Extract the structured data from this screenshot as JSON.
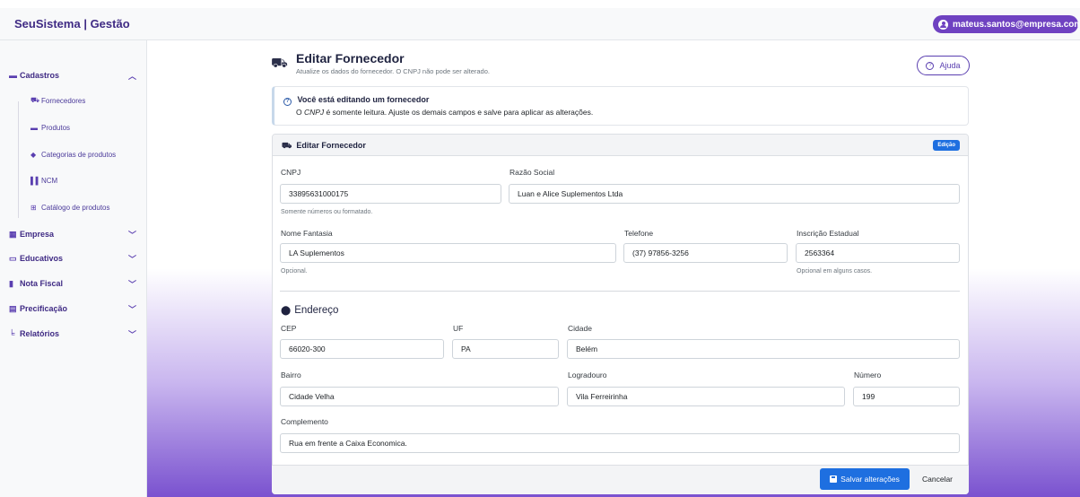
{
  "app": {
    "brand": "SeuSistema | Gestão",
    "user": "mateus.santos@empresa.com"
  },
  "sidebar": {
    "groups": [
      {
        "label": "Cadastros",
        "icon": "folder-icon",
        "expanded": true
      },
      {
        "label": "Empresa",
        "icon": "building-icon"
      },
      {
        "label": "Educativos",
        "icon": "presentation-icon"
      },
      {
        "label": "Nota Fiscal",
        "icon": "file-icon"
      },
      {
        "label": "Precificação",
        "icon": "calculator-icon"
      },
      {
        "label": "Relatórios",
        "icon": "chart-icon"
      }
    ],
    "cadastros_items": [
      {
        "label": "Fornecedores",
        "icon": "truck-icon"
      },
      {
        "label": "Produtos",
        "icon": "box-icon"
      },
      {
        "label": "Categorias de produtos",
        "icon": "tag-icon"
      },
      {
        "label": "NCM",
        "icon": "barcode-icon"
      },
      {
        "label": "Catálogo de produtos",
        "icon": "grid-icon"
      }
    ]
  },
  "page": {
    "title": "Editar Fornecedor",
    "subtitle": "Atualize os dados do fornecedor. O CNPJ não pode ser alterado.",
    "help_label": "Ajuda"
  },
  "alert": {
    "title": "Você está editando um fornecedor",
    "text_pre": "O ",
    "text_em": "CNPJ",
    "text_post": " é somente leitura. Ajuste os demais campos e salve para aplicar as alterações."
  },
  "card": {
    "title": "Editar Fornecedor",
    "badge": "Edição"
  },
  "form": {
    "cnpj": {
      "label": "CNPJ",
      "value": "33895631000175",
      "hint": "Somente números ou formatado."
    },
    "razao": {
      "label": "Razão Social",
      "value": "Luan e Alice Suplementos Ltda"
    },
    "fantasia": {
      "label": "Nome Fantasia",
      "value": "LA Suplementos",
      "hint": "Opcional."
    },
    "telefone": {
      "label": "Telefone",
      "value": "(37) 97856-3256"
    },
    "ie": {
      "label": "Inscrição Estadual",
      "value": "2563364",
      "hint": "Opcional em alguns casos."
    },
    "endereco_title": "Endereço",
    "cep": {
      "label": "CEP",
      "value": "66020-300"
    },
    "uf": {
      "label": "UF",
      "value": "PA"
    },
    "cidade": {
      "label": "Cidade",
      "value": "Belém"
    },
    "bairro": {
      "label": "Bairro",
      "value": "Cidade Velha"
    },
    "logradouro": {
      "label": "Logradouro",
      "value": "Vila Ferreirinha"
    },
    "numero": {
      "label": "Número",
      "value": "199"
    },
    "complemento": {
      "label": "Complemento",
      "value": "Rua em frente a Caixa Economica."
    }
  },
  "actions": {
    "save": "Salvar alterações",
    "cancel": "Cancelar"
  }
}
